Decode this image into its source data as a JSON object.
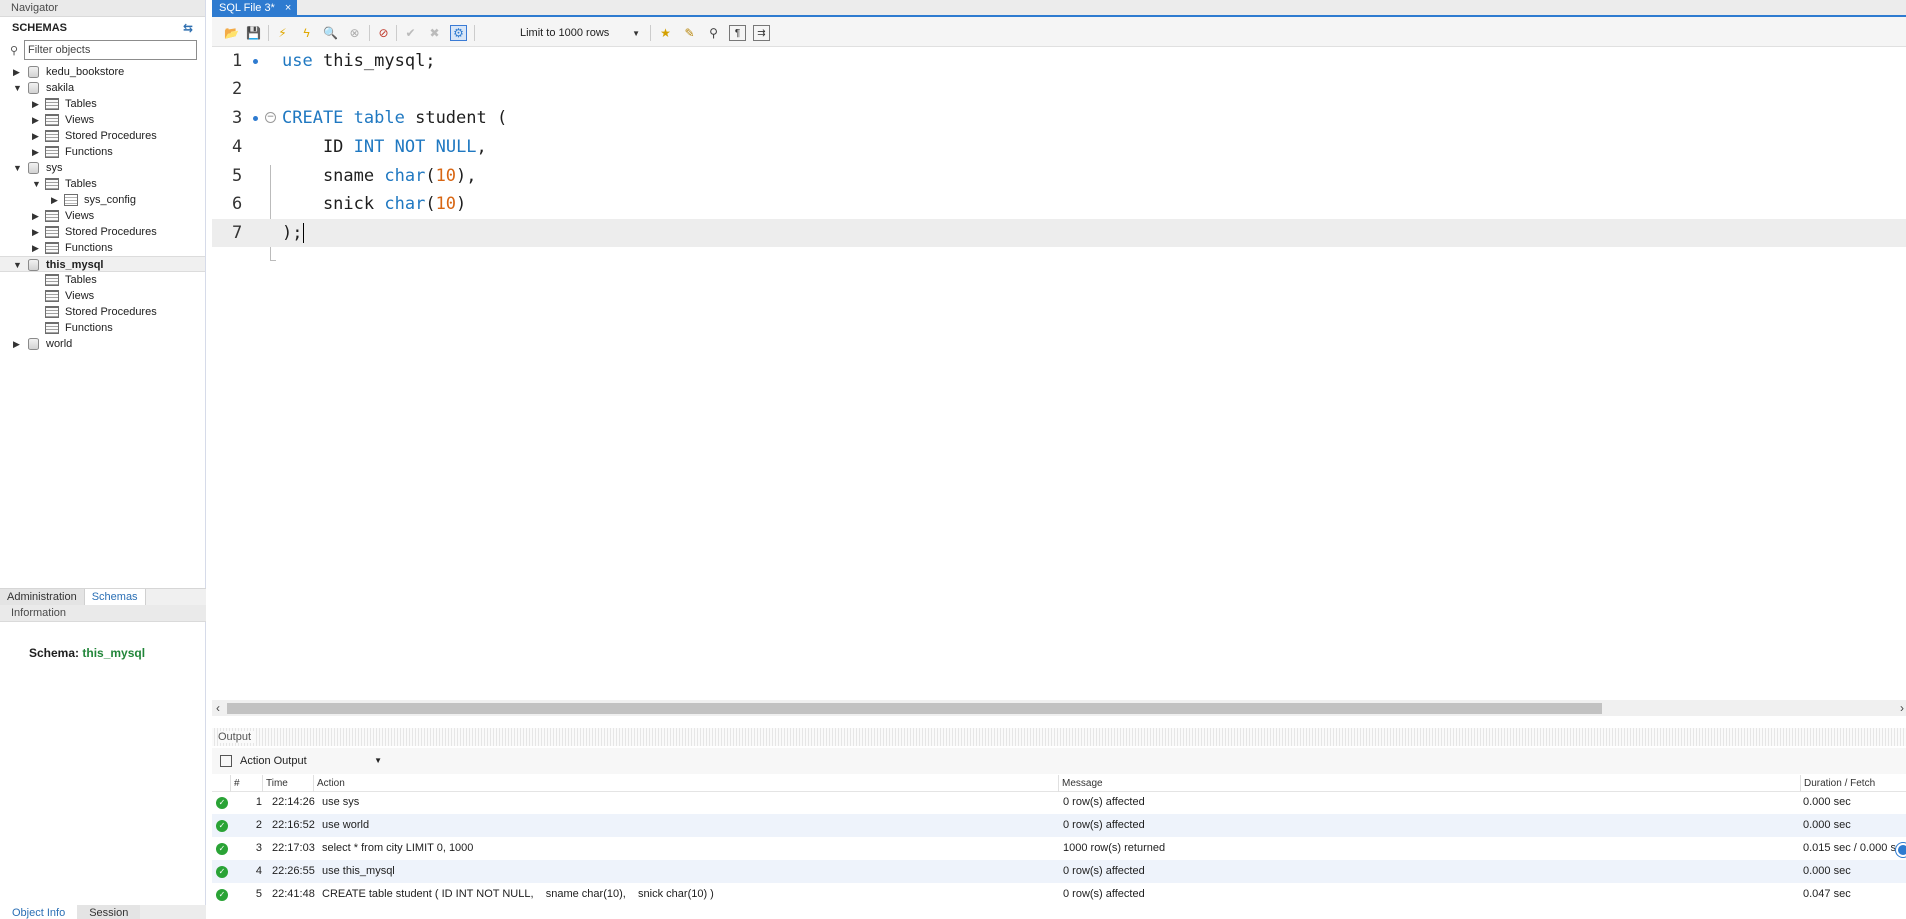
{
  "navigator": {
    "title": "Navigator",
    "schemas_label": "SCHEMAS",
    "filter_placeholder": "Filter objects",
    "tree": [
      {
        "label": "kedu_bookstore"
      },
      {
        "label": "sakila"
      },
      {
        "label": "Tables"
      },
      {
        "label": "Views"
      },
      {
        "label": "Stored Procedures"
      },
      {
        "label": "Functions"
      },
      {
        "label": "sys"
      },
      {
        "label": "Tables"
      },
      {
        "label": "sys_config"
      },
      {
        "label": "Views"
      },
      {
        "label": "Stored Procedures"
      },
      {
        "label": "Functions"
      },
      {
        "label": "this_mysql"
      },
      {
        "label": "Tables"
      },
      {
        "label": "Views"
      },
      {
        "label": "Stored Procedures"
      },
      {
        "label": "Functions"
      },
      {
        "label": "world"
      }
    ],
    "tabs": [
      "Administration",
      "Schemas"
    ],
    "information_title": "Information",
    "schema_label": "Schema:",
    "schema_value": "this_mysql",
    "bottom_tabs": [
      "Object Info",
      "Session"
    ]
  },
  "editor": {
    "tab_title": "SQL File 3*",
    "tab_close": "×",
    "limit_label": "Limit to 1000 rows",
    "line_numbers": [
      "1",
      "2",
      "3",
      "4",
      "5",
      "6",
      "7"
    ],
    "lines": [
      "use this_mysql;",
      "",
      "CREATE table student (",
      "    ID INT NOT NULL,",
      "    sname char(10),",
      "    snick char(10)",
      ");"
    ]
  },
  "output": {
    "title": "Output",
    "selector": "Action Output",
    "columns": [
      "#",
      "Time",
      "Action",
      "Message",
      "Duration / Fetch"
    ],
    "rows": [
      {
        "num": "1",
        "time": "22:14:26",
        "action": "use sys",
        "message": "0 row(s) affected",
        "duration": "0.000 sec"
      },
      {
        "num": "2",
        "time": "22:16:52",
        "action": "use world",
        "message": "0 row(s) affected",
        "duration": "0.000 sec"
      },
      {
        "num": "3",
        "time": "22:17:03",
        "action": "select * from city LIMIT 0, 1000",
        "message": "1000 row(s) returned",
        "duration": "0.015 sec / 0.000 s"
      },
      {
        "num": "4",
        "time": "22:26:55",
        "action": "use this_mysql",
        "message": "0 row(s) affected",
        "duration": "0.000 sec"
      },
      {
        "num": "5",
        "time": "22:41:48",
        "action": "CREATE table student ( ID INT NOT NULL,    sname char(10),    snick char(10) )",
        "message": "0 row(s) affected",
        "duration": "0.047 sec"
      }
    ]
  },
  "colors": {
    "accent": "#2e7bd0",
    "keyword": "#1f78c1",
    "number": "#d86613",
    "success": "#2aa336",
    "schema_value": "#22863a"
  }
}
